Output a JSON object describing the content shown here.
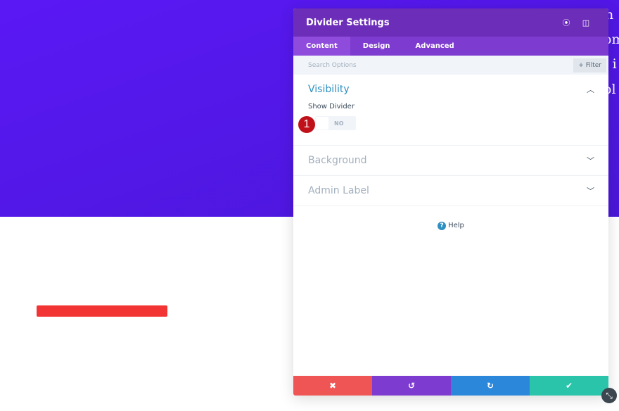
{
  "background": {
    "fragments": [
      "n",
      "om",
      "t i",
      "ol"
    ],
    "divider_color": "#f33434"
  },
  "panel": {
    "title": "Divider Settings",
    "tabs": [
      {
        "label": "Content"
      },
      {
        "label": "Design"
      },
      {
        "label": "Advanced"
      }
    ],
    "search_placeholder": "Search Options",
    "filter_label": "+ Filter",
    "sections": [
      {
        "label": "Visibility",
        "expanded": true
      },
      {
        "label": "Background"
      },
      {
        "label": "Admin Label"
      }
    ],
    "show_divider_label": "Show Divider",
    "toggle_value": "NO",
    "badge": "1",
    "help_label": "Help",
    "footer_colors": {
      "cancel": "#ef5555",
      "undo": "#7e3bd0",
      "redo": "#2b87da",
      "save": "#29c4a9"
    }
  }
}
